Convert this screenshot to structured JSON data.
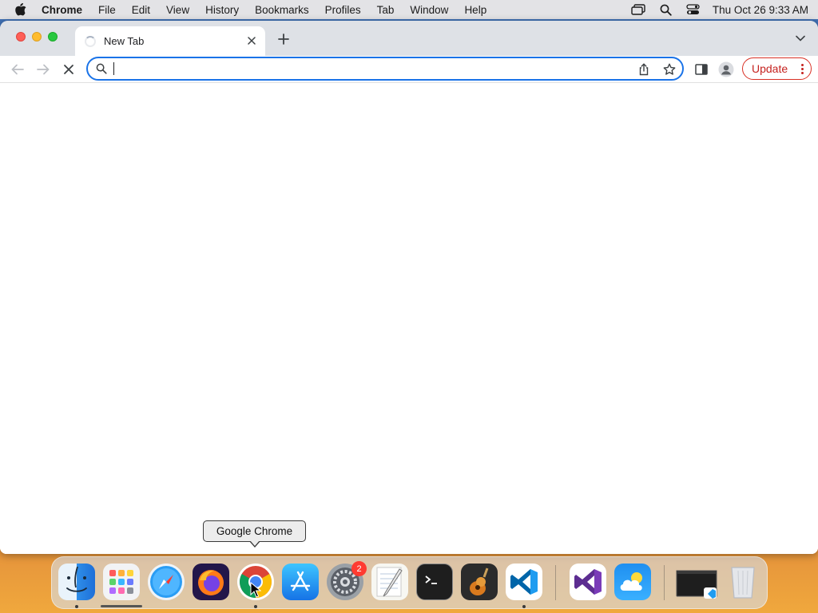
{
  "menubar": {
    "app_name": "Chrome",
    "items": [
      "File",
      "Edit",
      "View",
      "History",
      "Bookmarks",
      "Profiles",
      "Tab",
      "Window",
      "Help"
    ],
    "clock": "Thu Oct 26  9:33 AM",
    "status_icons": [
      "screen-mirroring-icon",
      "spotlight-search-icon",
      "control-center-icon"
    ]
  },
  "browser": {
    "tab": {
      "title": "New Tab",
      "loading": true
    },
    "omnibox": {
      "value": "",
      "placeholder": ""
    },
    "update_label": "Update",
    "colors": {
      "accent": "#1a73e8",
      "update": "#c5221f",
      "tabstrip": "#dee1e6"
    }
  },
  "dock": {
    "tooltip": "Google Chrome",
    "apps": [
      {
        "name": "Finder",
        "icon": "finder-icon",
        "running": true
      },
      {
        "name": "Launchpad",
        "icon": "launchpad-icon",
        "running": false
      },
      {
        "name": "Safari",
        "icon": "safari-icon",
        "running": false
      },
      {
        "name": "Firefox",
        "icon": "firefox-icon",
        "running": false
      },
      {
        "name": "Google Chrome",
        "icon": "chrome-icon",
        "running": true
      },
      {
        "name": "App Store",
        "icon": "app-store-icon",
        "running": false
      },
      {
        "name": "System Preferences",
        "icon": "system-preferences-icon",
        "running": false,
        "badge": "2"
      },
      {
        "name": "TextEdit",
        "icon": "textedit-icon",
        "running": false
      },
      {
        "name": "Terminal",
        "icon": "terminal-icon",
        "running": false
      },
      {
        "name": "GarageBand",
        "icon": "garageband-icon",
        "running": false
      },
      {
        "name": "Visual Studio Code",
        "icon": "vscode-icon",
        "running": true
      },
      {
        "name": "Visual Studio",
        "icon": "visual-studio-icon",
        "running": false
      },
      {
        "name": "Weather",
        "icon": "weather-icon",
        "running": false
      },
      {
        "name": "VS Code Window",
        "icon": "minimized-window-icon",
        "running": false
      },
      {
        "name": "Trash",
        "icon": "trash-icon",
        "running": false
      }
    ]
  }
}
